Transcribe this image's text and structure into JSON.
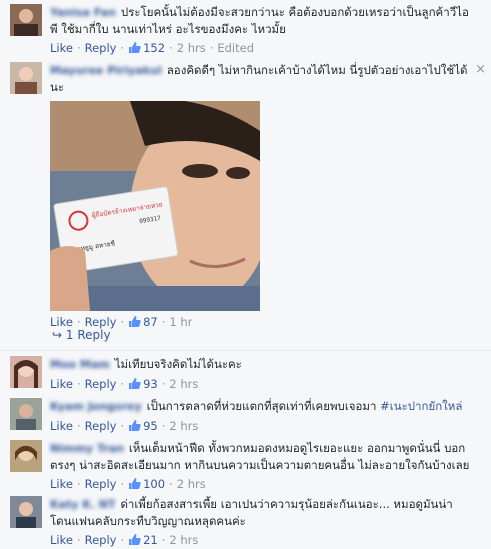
{
  "actions": {
    "like": "Like",
    "reply": "Reply",
    "sep": "·"
  },
  "comments": [
    {
      "name": "Yanisa Fan",
      "text": "ประโยคนั้นไม่ต้องมีจะสวยกว่านะ คือต้องบอกด้วยเหรอว่าเป็นลูกค้าวีไอพี ใช้มากี่ใบ นานเท่าไหร่ อะไรของมึงคะ ไหวมั้ย",
      "likes": "152",
      "time": "2 hrs",
      "edited": "Edited"
    },
    {
      "name": "Mayuree Piriyakul",
      "text": "ลองคิดดีๆ ไม่หากินกะเค้าบ้างได้ไหม นี่รูปตัวอย่างเอาไปใช้ได้นะ",
      "likes": "87",
      "time": "1 hr",
      "card_title": "ผู้ถือบัตรจ้างเหมาจ่ายห่วย",
      "card_name": "นายหยูมู สหายชื",
      "card_number": "099317"
    },
    {
      "name": "Moo Mam",
      "text": "ไม่เทียบจริงคิดไม่ได้นะคะ",
      "likes": "93",
      "time": "2 hrs"
    },
    {
      "name": "Kyam Jongsrey",
      "text": "เป็นการตลาดที่ห่วยแตกที่สุดเท่าที่เคยพบเจอมา ",
      "hashtag": "#เนะปากยักใหล่",
      "likes": "95",
      "time": "2 hrs"
    },
    {
      "name": "Nimmy Tran",
      "text": "เห็นเต็มหน้าฟีด ทั้งพวกหมอดงหมอดูไรเยอะแยะ ออกมาพูดนั่นนี่ บอกตรงๆ น่าสะอิดสะเอียนมาก หากินบนความเป็นความตายคนอื่น ไม่ละอายใจกันบ้างเลย",
      "likes": "100",
      "time": "2 hrs"
    },
    {
      "name": "Katy K. NT",
      "text": "ด่าเพี้ยก้อสงสารเพี้ย เอาเปนว่าความรุน้อยล่ะกันเนอะ... หมอดูมันน่าโดนแฟนคลับกระทืบวิญญาณหลุดคนค่ะ",
      "likes": "21",
      "time": "2 hrs"
    }
  ],
  "replies_link": "1 Reply",
  "close_glyph": "×"
}
